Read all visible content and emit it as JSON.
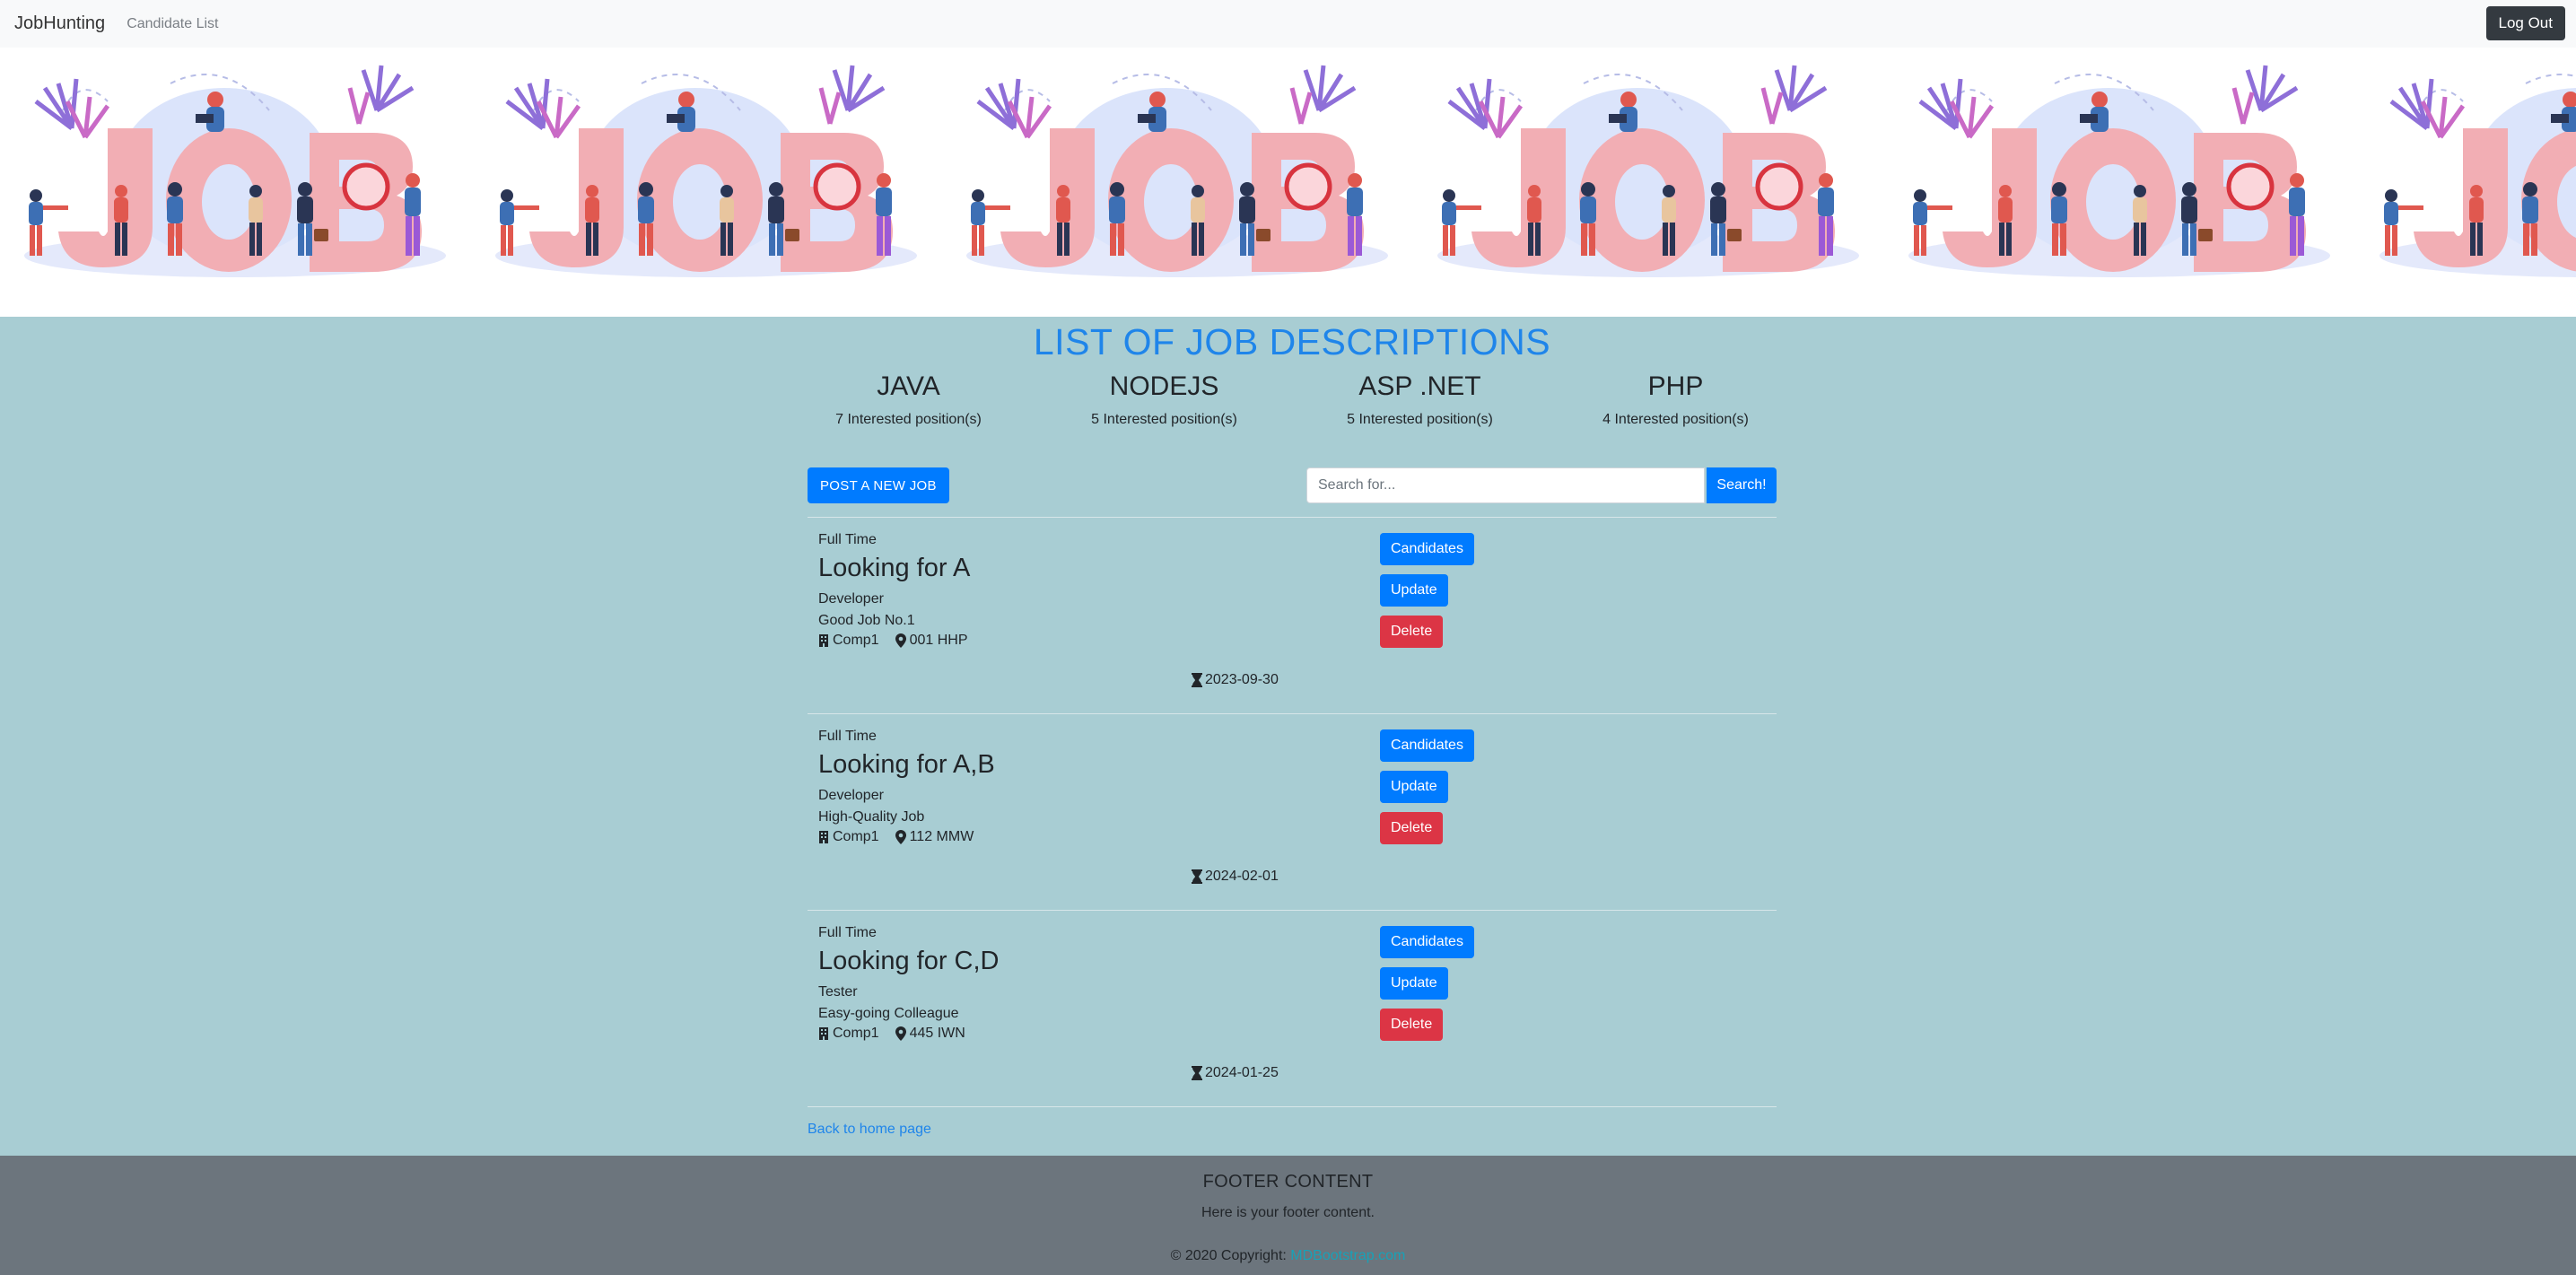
{
  "navbar": {
    "brand": "JobHunting",
    "link": "Candidate List",
    "logout": "Log Out"
  },
  "page_title": "LIST OF JOB DESCRIPTIONS",
  "skills": [
    {
      "name": "JAVA",
      "count": "7 Interested position(s)"
    },
    {
      "name": "NODEJS",
      "count": "5 Interested position(s)"
    },
    {
      "name": "ASP .NET",
      "count": "5 Interested position(s)"
    },
    {
      "name": "PHP",
      "count": "4 Interested position(s)"
    }
  ],
  "toolbar": {
    "post_label": "POST A NEW JOB",
    "search_placeholder": "Search for...",
    "search_label": "Search!"
  },
  "jobs": [
    {
      "type": "Full Time",
      "title": "Looking for A",
      "role": "Developer",
      "desc": "Good Job No.1",
      "company": "Comp1",
      "location": "001 HHP",
      "deadline": "2023-09-30"
    },
    {
      "type": "Full Time",
      "title": "Looking for A,B",
      "role": "Developer",
      "desc": "High-Quality Job",
      "company": "Comp1",
      "location": "112 MMW",
      "deadline": "2024-02-01"
    },
    {
      "type": "Full Time",
      "title": "Looking for C,D",
      "role": "Tester",
      "desc": "Easy-going Colleague",
      "company": "Comp1",
      "location": "445 IWN",
      "deadline": "2024-01-25"
    }
  ],
  "actions": {
    "candidates": "Candidates",
    "update": "Update",
    "delete": "Delete"
  },
  "back_link": "Back to home page",
  "footer": {
    "title": "FOOTER CONTENT",
    "text": "Here is your footer content.",
    "copyright": "© 2020 Copyright:",
    "copyright_link": "MDBootstrap.com"
  },
  "banner_letters": "JOB",
  "colors": {
    "accent": "#007bff",
    "danger": "#dc3545",
    "title": "#1f85ea",
    "background": "#a8cdd3",
    "footer": "#6c757d"
  }
}
